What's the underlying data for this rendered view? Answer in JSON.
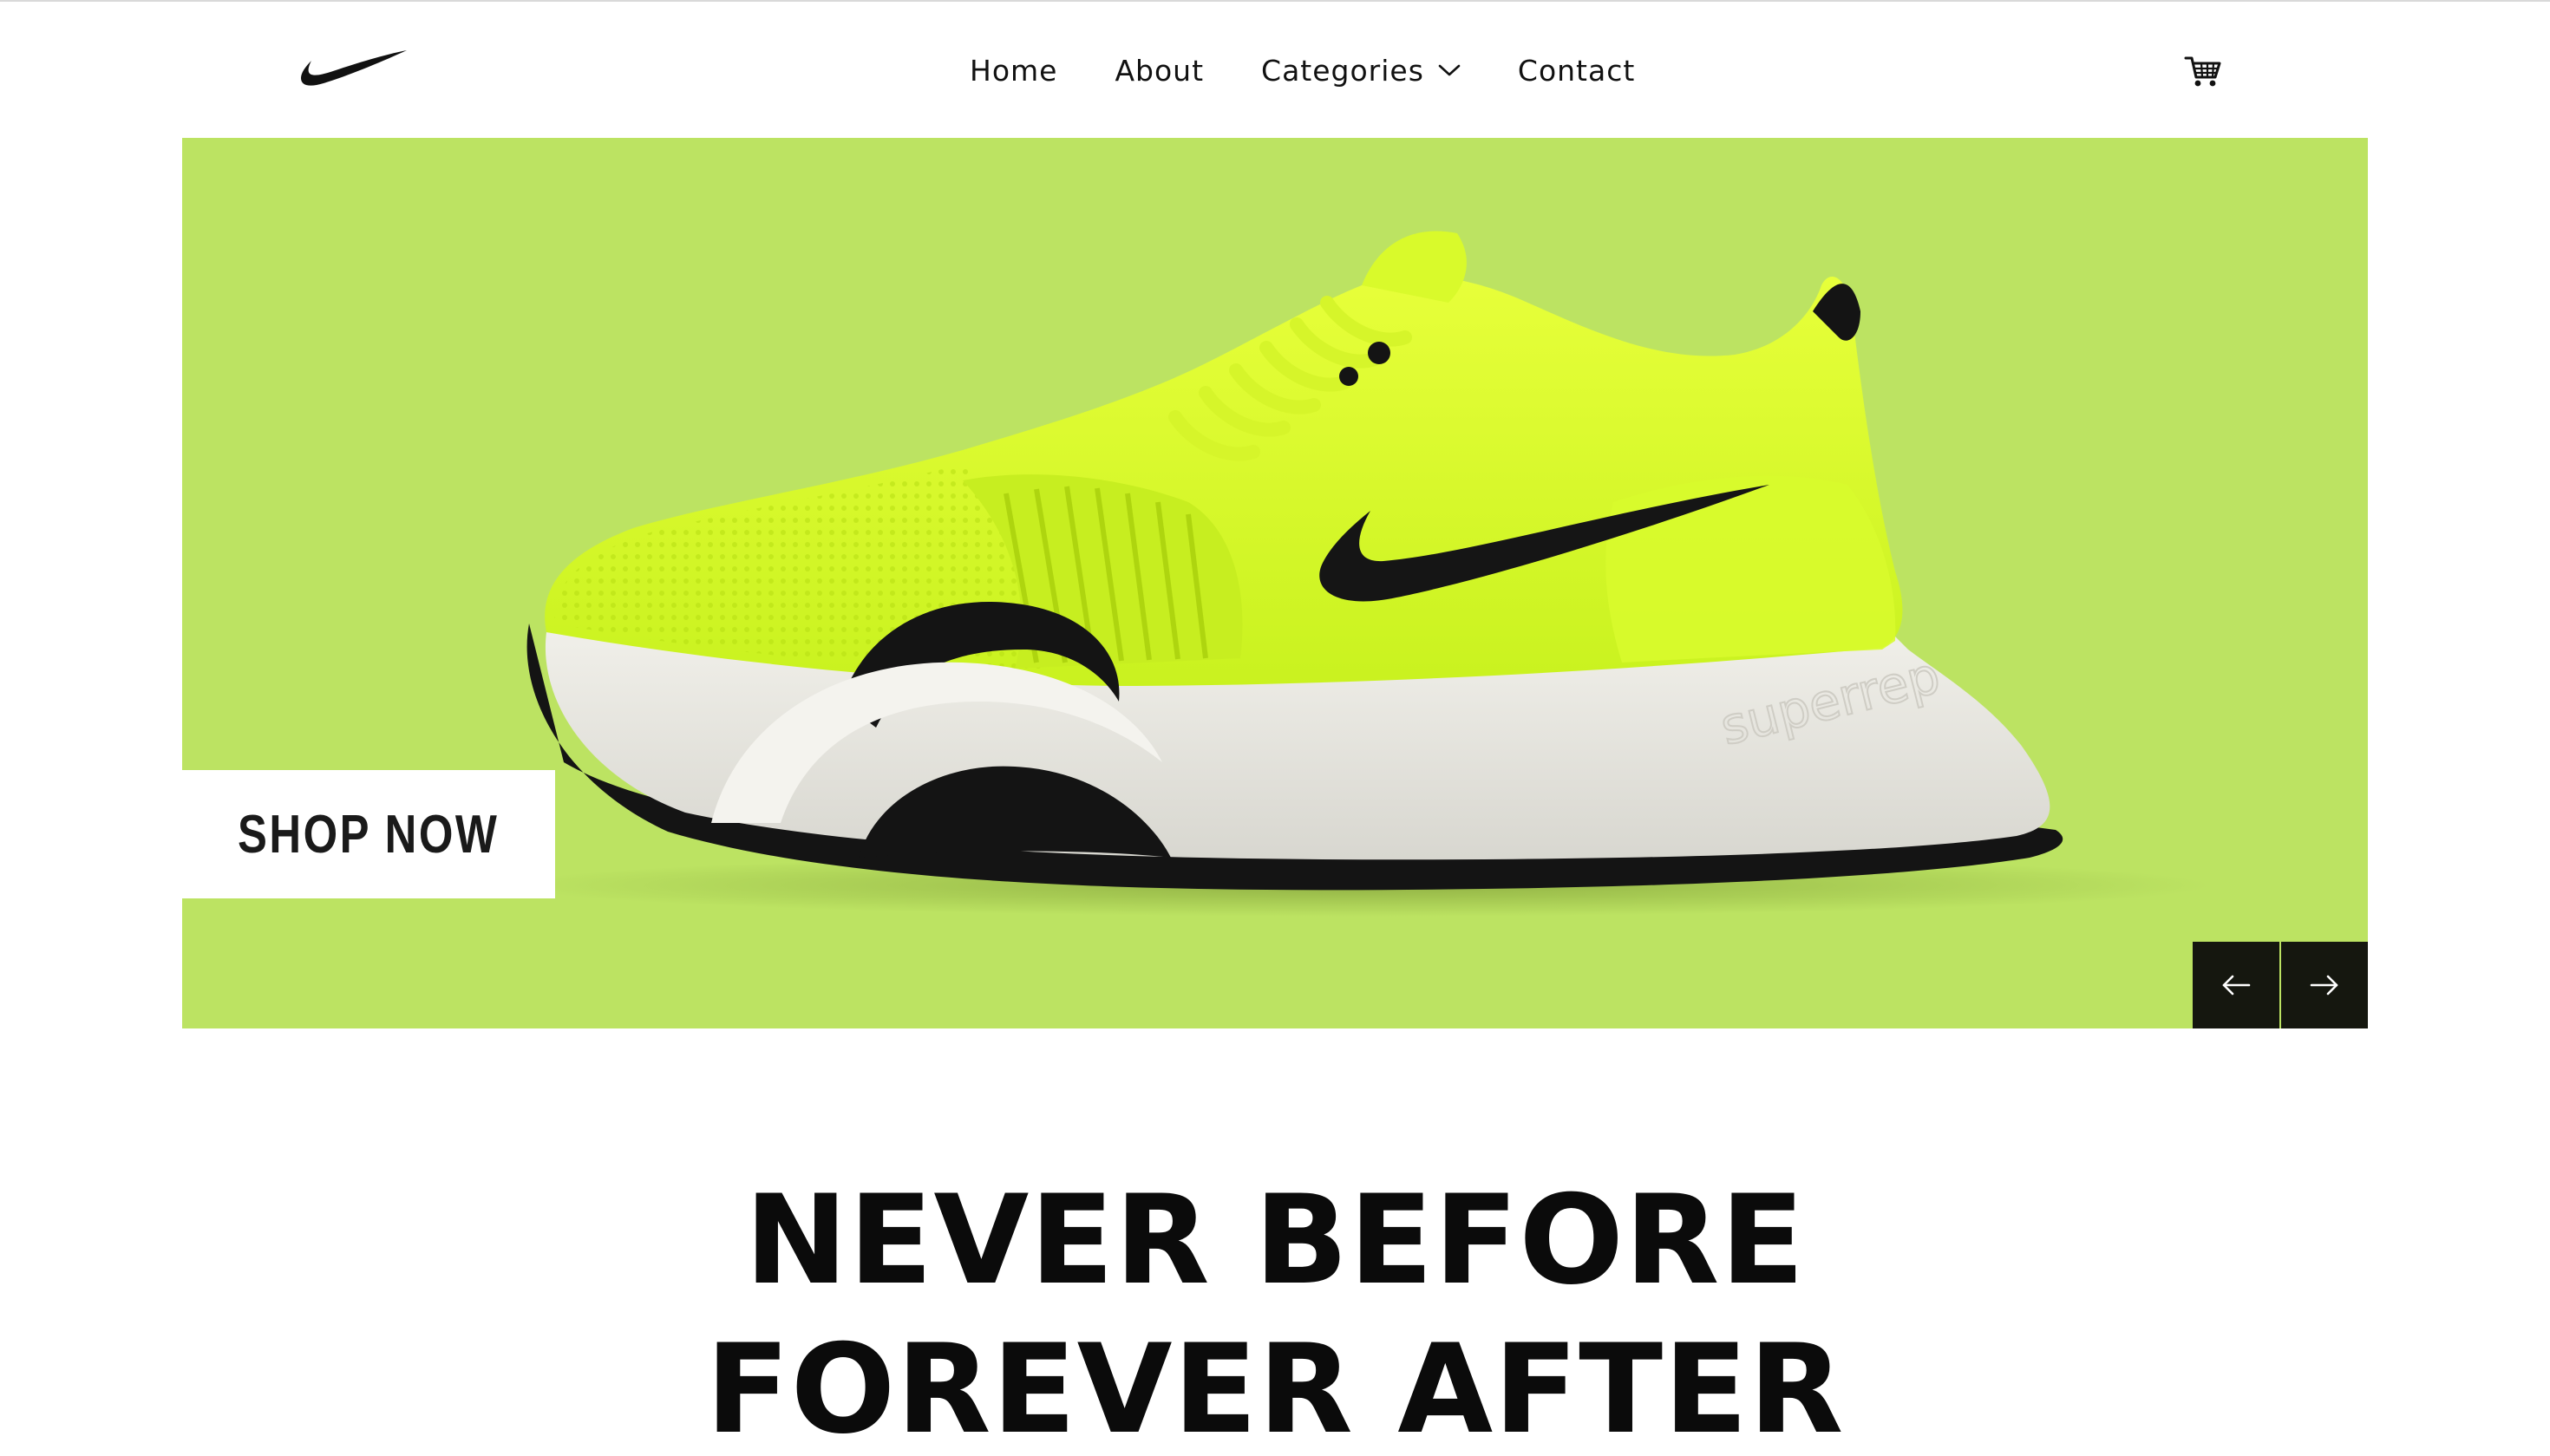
{
  "header": {
    "brand": "Nike",
    "nav": {
      "home": "Home",
      "about": "About",
      "categories": "Categories",
      "contact": "Contact"
    }
  },
  "hero": {
    "cta_label": "SHOP NOW",
    "shoe_model_text": "superrep",
    "background_color": "#bce362"
  },
  "headline": {
    "line1": "NEVER BEFORE",
    "line2": "FOREVER AFTER"
  },
  "icons": {
    "logo": "nike-swoosh-logo",
    "categories_toggle": "chevron-down-icon",
    "cart": "shopping-cart-icon",
    "previous": "arrow-left-icon",
    "next": "arrow-right-icon"
  }
}
